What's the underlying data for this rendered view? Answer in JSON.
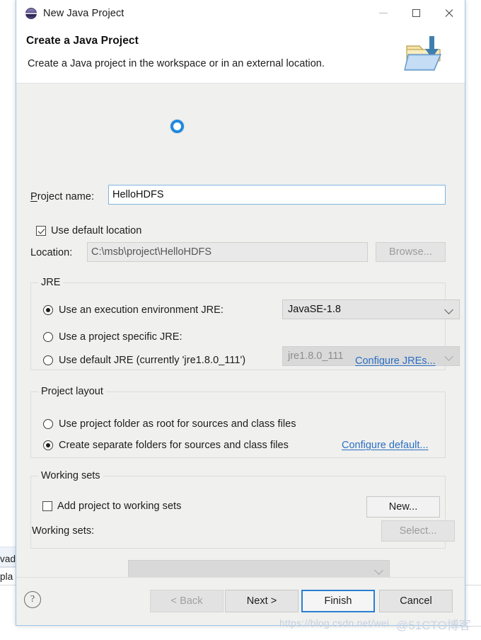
{
  "window": {
    "title": "New Java Project",
    "icon": "java-project-icon",
    "controls": {
      "minimize": "minimize-button",
      "maximize": "maximize-button",
      "close": "close-button"
    }
  },
  "header": {
    "title": "Create a Java Project",
    "description": "Create a Java project in the workspace or in an external location.",
    "icon": "folder-import-icon"
  },
  "form": {
    "project_name": {
      "label": "Project name:",
      "value": "HelloHDFS",
      "placeholder": ""
    },
    "use_default_location": {
      "label": "Use default location",
      "checked": true
    },
    "location": {
      "label": "Location:",
      "value": "C:\\msb\\project\\HelloHDFS",
      "browse_label": "Browse...",
      "disabled": true
    }
  },
  "jre": {
    "group_title": "JRE",
    "options": [
      {
        "label": "Use an execution environment JRE:",
        "selected": true
      },
      {
        "label": "Use a project specific JRE:",
        "selected": false
      },
      {
        "label": "Use default JRE (currently 'jre1.8.0_111')",
        "selected": false
      }
    ],
    "execution_environment": {
      "value": "JavaSE-1.8",
      "disabled": false
    },
    "specific_jre": {
      "value": "jre1.8.0_111",
      "disabled": true
    },
    "configure_link": "Configure JREs..."
  },
  "project_layout": {
    "group_title": "Project layout",
    "options": [
      {
        "label": "Use project folder as root for sources and class files",
        "selected": false
      },
      {
        "label": "Create separate folders for sources and class files",
        "selected": true
      }
    ],
    "configure_link": "Configure default..."
  },
  "working_sets": {
    "group_title": "Working sets",
    "add_checkbox": {
      "label": "Add project to working sets",
      "checked": false
    },
    "new_button": "New...",
    "sets_label": "Working sets:",
    "sets_value": "",
    "select_button": "Select...",
    "disabled": true
  },
  "footer": {
    "help": "?",
    "buttons": [
      {
        "label": "< Back",
        "state": "disabled"
      },
      {
        "label": "Next >",
        "state": "enabled"
      },
      {
        "label": "Finish",
        "state": "default"
      },
      {
        "label": "Cancel",
        "state": "enabled"
      }
    ]
  },
  "backdrop": {
    "text_top": "vad",
    "text_bottom": "pla"
  },
  "watermark": {
    "url": "https://blog.csdn.net/wei",
    "brand": "@51CTO博客"
  },
  "colors": {
    "accent": "#2a7fd4",
    "link": "#2a6fc4",
    "dialog_bg": "#f0f0ee",
    "header_bg": "#ffffff",
    "border": "#9ec6e8"
  }
}
